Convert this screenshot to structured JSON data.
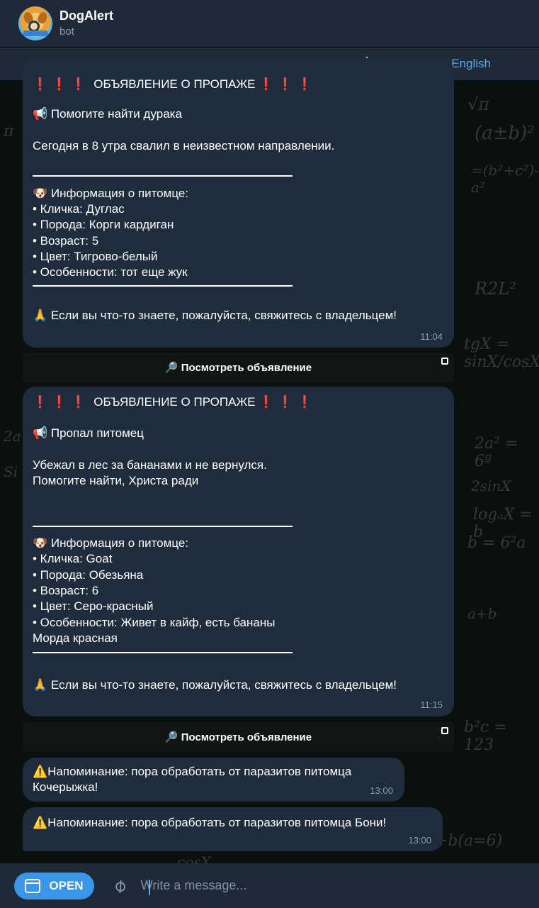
{
  "header": {
    "title": "DogAlert",
    "subtitle": "bot"
  },
  "translate": {
    "label": "Translate to English"
  },
  "messages": [
    {
      "top_line": "❗❗❗ ОБЪЯВЛЕНИЕ О ПРОПАЖЕ ❗❗❗",
      "headline": "📢 Помогите найти дурака",
      "description": [
        "Сегодня в 8 утра свалил в неизвестном направлении."
      ],
      "info_title": "🐶 Информация о питомце:",
      "info": [
        "• Кличка: Дуглас",
        "• Порода: Корги кардиган",
        "• Возраст: 5",
        "• Цвет: Тигрово-белый",
        "• Особенности: тот еще жук"
      ],
      "footer": "🙏 Если вы что-то знаете, пожалуйста, свяжитесь с владельцем!",
      "time": "11:04"
    },
    {
      "top_line": "❗❗❗ ОБЪЯВЛЕНИЕ О ПРОПАЖЕ ❗❗❗",
      "headline": "📢 Пропал питомец",
      "description": [
        "Убежал в лес за бананами и не вернулся.",
        "Помогите найти, Христа ради"
      ],
      "info_title": "🐶 Информация о питомце:",
      "info": [
        "• Кличка: Goat",
        "• Порода: Обезьяна",
        "• Возраст: 6",
        "• Цвет: Серо-красный",
        "• Особенности: Живет в кайф, есть бананы",
        "Морда красная"
      ],
      "footer": "🙏 Если вы что-то знаете, пожалуйста, свяжитесь с владельцем!",
      "time": "11:15"
    }
  ],
  "inline_button": {
    "label": "🔎 Посмотреть объявление"
  },
  "reminders": [
    {
      "lines": [
        "⚠️Напоминание: пора обработать от паразитов питомца",
        "Кочерыжка!"
      ],
      "time": "13:00"
    },
    {
      "lines": [
        "⚠️Напоминание: пора обработать от паразитов питомца Бони!"
      ],
      "time": "13:00"
    }
  ],
  "composer": {
    "open_label": "OPEN",
    "placeholder": "Write a message..."
  },
  "colors": {
    "accent": "#3a97e8",
    "bubble": "#1f2c3d",
    "header": "#1e2a38",
    "alert_red": "#e2342c"
  }
}
